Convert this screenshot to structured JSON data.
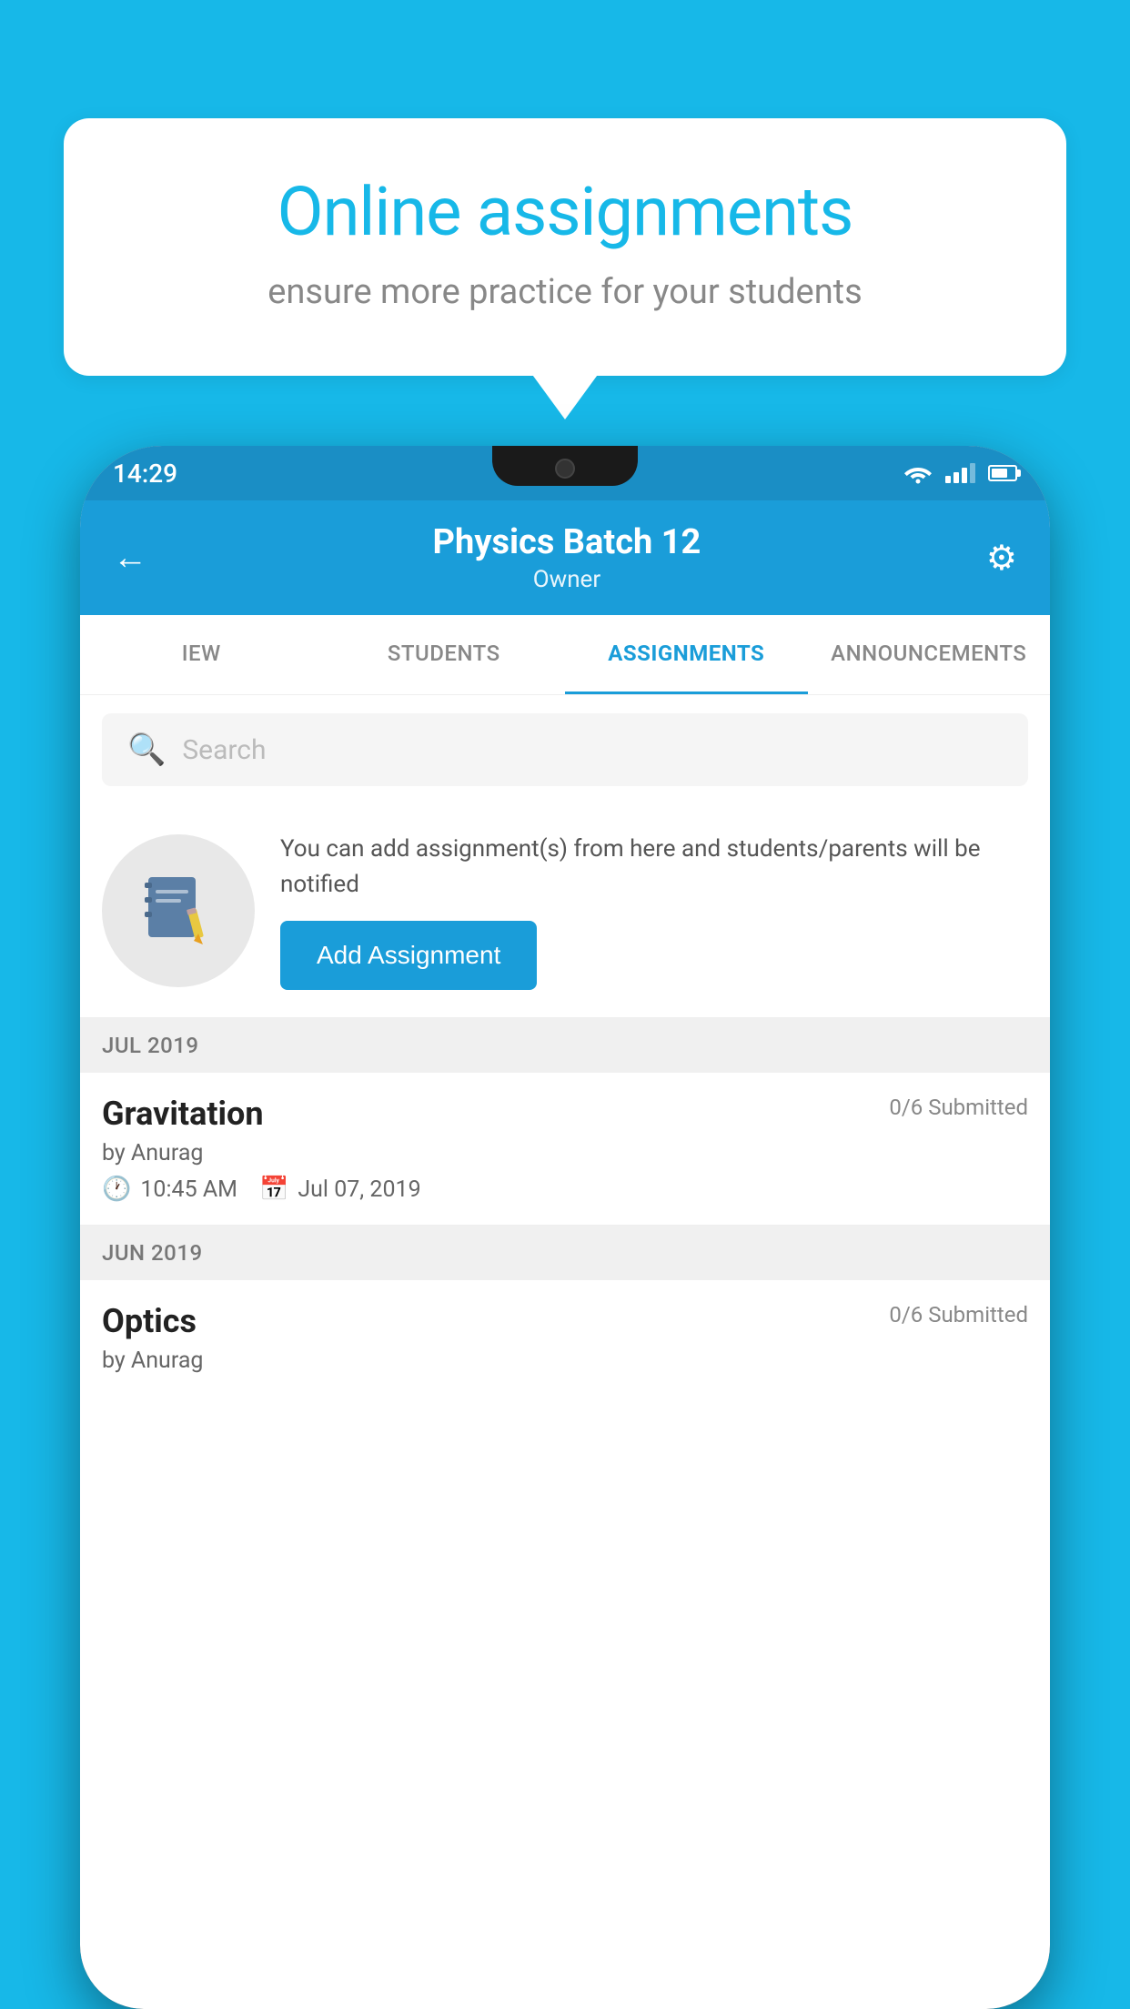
{
  "background": {
    "color": "#17b8e8"
  },
  "speech_bubble": {
    "title": "Online assignments",
    "subtitle": "ensure more practice for your students"
  },
  "phone": {
    "status_bar": {
      "time": "14:29"
    },
    "header": {
      "title": "Physics Batch 12",
      "subtitle": "Owner",
      "back_label": "←",
      "settings_label": "⚙"
    },
    "tabs": [
      {
        "label": "IEW",
        "active": false
      },
      {
        "label": "STUDENTS",
        "active": false
      },
      {
        "label": "ASSIGNMENTS",
        "active": true
      },
      {
        "label": "ANNOUNCEMENTS",
        "active": false
      }
    ],
    "search": {
      "placeholder": "Search"
    },
    "promo": {
      "description": "You can add assignment(s) from here and students/parents will be notified",
      "button_label": "Add Assignment"
    },
    "sections": [
      {
        "month_label": "JUL 2019",
        "assignments": [
          {
            "title": "Gravitation",
            "submitted": "0/6 Submitted",
            "by": "by Anurag",
            "time": "10:45 AM",
            "date": "Jul 07, 2019"
          }
        ]
      },
      {
        "month_label": "JUN 2019",
        "assignments": [
          {
            "title": "Optics",
            "submitted": "0/6 Submitted",
            "by": "by Anurag",
            "time": "",
            "date": ""
          }
        ]
      }
    ]
  }
}
